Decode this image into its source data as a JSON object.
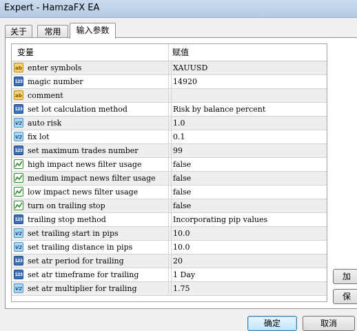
{
  "window": {
    "title": "Expert - HamzaFX EA"
  },
  "tabs": [
    {
      "label": "关于"
    },
    {
      "label": "常用"
    },
    {
      "label": "输入参数"
    }
  ],
  "table": {
    "columns": [
      "变量",
      "赋值"
    ],
    "rows": [
      {
        "icon": "ab-string-icon",
        "name": "enter symbols",
        "value": "XAUUSD"
      },
      {
        "icon": "integer-123-icon",
        "name": "magic number",
        "value": "14920"
      },
      {
        "icon": "ab-string-icon",
        "name": "comment",
        "value": ""
      },
      {
        "icon": "integer-123-icon",
        "name": "set lot calculation method",
        "value": "Risk by balance percent"
      },
      {
        "icon": "double-v2-icon",
        "name": "auto risk",
        "value": "1.0"
      },
      {
        "icon": "double-v2-icon",
        "name": "fix lot",
        "value": "0.1"
      },
      {
        "icon": "integer-123-icon",
        "name": "set maximum trades number",
        "value": "99"
      },
      {
        "icon": "bool-chart-icon",
        "name": "high impact news filter usage",
        "value": "false"
      },
      {
        "icon": "bool-chart-icon",
        "name": "medium impact news filter usage",
        "value": "false"
      },
      {
        "icon": "bool-chart-icon",
        "name": "low impact news filter usage",
        "value": "false"
      },
      {
        "icon": "bool-chart-icon",
        "name": "turn on trailing stop",
        "value": "false"
      },
      {
        "icon": "integer-123-icon",
        "name": "trailing stop method",
        "value": "Incorporating pip values"
      },
      {
        "icon": "double-v2-icon",
        "name": "set trailing start in pips",
        "value": "10.0"
      },
      {
        "icon": "double-v2-icon",
        "name": "set trailing distance in pips",
        "value": "10.0"
      },
      {
        "icon": "integer-123-icon",
        "name": "set atr period for trailing",
        "value": "20"
      },
      {
        "icon": "integer-123-icon",
        "name": "set atr timeframe for trailing",
        "value": "1 Day"
      },
      {
        "icon": "double-v2-icon",
        "name": "set atr multiplier for trailing",
        "value": "1.75"
      }
    ]
  },
  "side_buttons": [
    {
      "label": "加"
    },
    {
      "label": "保"
    }
  ],
  "footer": {
    "ok_label": "确定",
    "cancel_label": "取消"
  }
}
